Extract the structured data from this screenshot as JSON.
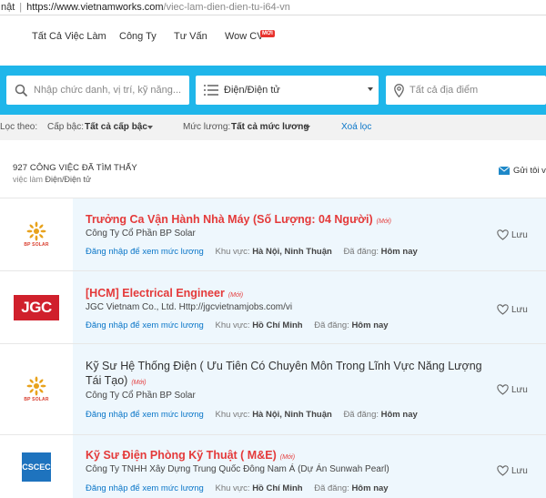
{
  "address": {
    "security": "nật",
    "host": "https://www.vietnamworks.com",
    "path": "/viec-lam-dien-dien-tu-i64-vn"
  },
  "nav": {
    "items": [
      "Tất Cả Việc Làm",
      "Công Ty",
      "Tư Vấn",
      "Wow CV"
    ],
    "badge": "MỚI"
  },
  "search": {
    "keyword_placeholder": "Nhập chức danh, vị trí, kỹ năng...",
    "category_value": "Điện/Điện tử",
    "location_placeholder": "Tất cả địa điểm"
  },
  "filters": {
    "label": "Lọc theo:",
    "level_label": "Cấp bậc:",
    "level_value": "Tất cả cấp bậc",
    "salary_label": "Mức lương:",
    "salary_value": "Tất cả mức lương",
    "clear_label": "Xoá lọc"
  },
  "results": {
    "count_text": "927 CÔNG VIỆC ĐÃ TÌM THẤY",
    "sub_prefix": "việc làm",
    "sub_category": "Điện/Điện tử",
    "email_label": "Gửi tôi v"
  },
  "common": {
    "new_tag": "(Mới)",
    "login_salary": "Đăng nhập để xem mức lương",
    "area_label": "Khu vực:",
    "posted_label": "Đã đăng:",
    "save_label": "Lưu"
  },
  "jobs": [
    {
      "title": "Trưởng Ca Vận Hành Nhà Máy (Số Lượng: 04 Người)",
      "company": "Công Ty Cổ Phần BP Solar",
      "area": "Hà Nội, Ninh Thuận",
      "posted": "Hôm nay",
      "logo_text": "BP SOLAR"
    },
    {
      "title": "[HCM] Electrical Engineer",
      "company": "JGC Vietnam Co., Ltd. Http://jgcvietnamjobs.com/vi",
      "area": "Hồ Chí Minh",
      "posted": "Hôm nay",
      "logo_text": "JGC"
    },
    {
      "title": "Kỹ Sư Hệ Thống Điện ( Ưu Tiên Có Chuyên Môn Trong Lĩnh Vực Năng Lượng Tái Tạo)",
      "company": "Công Ty Cổ Phần BP Solar",
      "area": "Hà Nội, Ninh Thuận",
      "posted": "Hôm nay",
      "logo_text": "BP SOLAR"
    },
    {
      "title": "Kỹ Sư Điện Phòng Kỹ Thuật ( M&E)",
      "company": "Công Ty TNHH Xây Dựng Trung Quốc Đông Nam Á (Dự Án Sunwah Pearl)",
      "area": "Hồ Chí Minh",
      "posted": "Hôm nay",
      "logo_text": "CSCEC"
    }
  ],
  "colors": {
    "search_bar": "#1fb6ea",
    "title_red": "#e43a3a",
    "link_blue": "#0a76c8",
    "row_bg": "#eef7fd"
  }
}
